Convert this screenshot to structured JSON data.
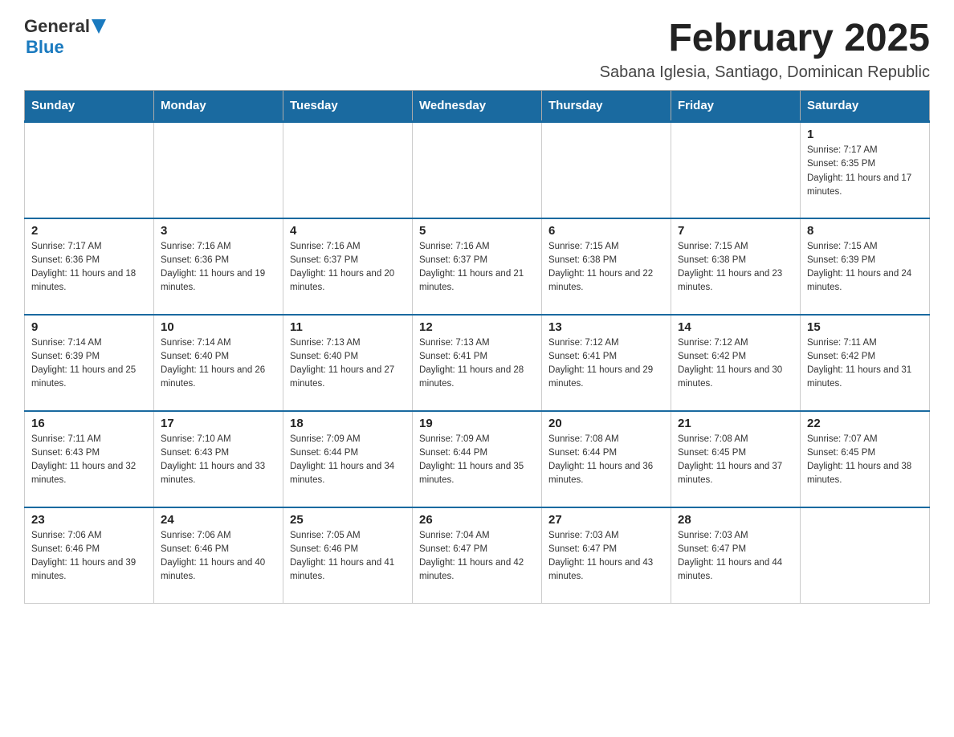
{
  "header": {
    "logo_general": "General",
    "logo_blue": "Blue",
    "title": "February 2025",
    "subtitle": "Sabana Iglesia, Santiago, Dominican Republic"
  },
  "weekdays": [
    "Sunday",
    "Monday",
    "Tuesday",
    "Wednesday",
    "Thursday",
    "Friday",
    "Saturday"
  ],
  "weeks": [
    [
      {
        "day": "",
        "sunrise": "",
        "sunset": "",
        "daylight": ""
      },
      {
        "day": "",
        "sunrise": "",
        "sunset": "",
        "daylight": ""
      },
      {
        "day": "",
        "sunrise": "",
        "sunset": "",
        "daylight": ""
      },
      {
        "day": "",
        "sunrise": "",
        "sunset": "",
        "daylight": ""
      },
      {
        "day": "",
        "sunrise": "",
        "sunset": "",
        "daylight": ""
      },
      {
        "day": "",
        "sunrise": "",
        "sunset": "",
        "daylight": ""
      },
      {
        "day": "1",
        "sunrise": "Sunrise: 7:17 AM",
        "sunset": "Sunset: 6:35 PM",
        "daylight": "Daylight: 11 hours and 17 minutes."
      }
    ],
    [
      {
        "day": "2",
        "sunrise": "Sunrise: 7:17 AM",
        "sunset": "Sunset: 6:36 PM",
        "daylight": "Daylight: 11 hours and 18 minutes."
      },
      {
        "day": "3",
        "sunrise": "Sunrise: 7:16 AM",
        "sunset": "Sunset: 6:36 PM",
        "daylight": "Daylight: 11 hours and 19 minutes."
      },
      {
        "day": "4",
        "sunrise": "Sunrise: 7:16 AM",
        "sunset": "Sunset: 6:37 PM",
        "daylight": "Daylight: 11 hours and 20 minutes."
      },
      {
        "day": "5",
        "sunrise": "Sunrise: 7:16 AM",
        "sunset": "Sunset: 6:37 PM",
        "daylight": "Daylight: 11 hours and 21 minutes."
      },
      {
        "day": "6",
        "sunrise": "Sunrise: 7:15 AM",
        "sunset": "Sunset: 6:38 PM",
        "daylight": "Daylight: 11 hours and 22 minutes."
      },
      {
        "day": "7",
        "sunrise": "Sunrise: 7:15 AM",
        "sunset": "Sunset: 6:38 PM",
        "daylight": "Daylight: 11 hours and 23 minutes."
      },
      {
        "day": "8",
        "sunrise": "Sunrise: 7:15 AM",
        "sunset": "Sunset: 6:39 PM",
        "daylight": "Daylight: 11 hours and 24 minutes."
      }
    ],
    [
      {
        "day": "9",
        "sunrise": "Sunrise: 7:14 AM",
        "sunset": "Sunset: 6:39 PM",
        "daylight": "Daylight: 11 hours and 25 minutes."
      },
      {
        "day": "10",
        "sunrise": "Sunrise: 7:14 AM",
        "sunset": "Sunset: 6:40 PM",
        "daylight": "Daylight: 11 hours and 26 minutes."
      },
      {
        "day": "11",
        "sunrise": "Sunrise: 7:13 AM",
        "sunset": "Sunset: 6:40 PM",
        "daylight": "Daylight: 11 hours and 27 minutes."
      },
      {
        "day": "12",
        "sunrise": "Sunrise: 7:13 AM",
        "sunset": "Sunset: 6:41 PM",
        "daylight": "Daylight: 11 hours and 28 minutes."
      },
      {
        "day": "13",
        "sunrise": "Sunrise: 7:12 AM",
        "sunset": "Sunset: 6:41 PM",
        "daylight": "Daylight: 11 hours and 29 minutes."
      },
      {
        "day": "14",
        "sunrise": "Sunrise: 7:12 AM",
        "sunset": "Sunset: 6:42 PM",
        "daylight": "Daylight: 11 hours and 30 minutes."
      },
      {
        "day": "15",
        "sunrise": "Sunrise: 7:11 AM",
        "sunset": "Sunset: 6:42 PM",
        "daylight": "Daylight: 11 hours and 31 minutes."
      }
    ],
    [
      {
        "day": "16",
        "sunrise": "Sunrise: 7:11 AM",
        "sunset": "Sunset: 6:43 PM",
        "daylight": "Daylight: 11 hours and 32 minutes."
      },
      {
        "day": "17",
        "sunrise": "Sunrise: 7:10 AM",
        "sunset": "Sunset: 6:43 PM",
        "daylight": "Daylight: 11 hours and 33 minutes."
      },
      {
        "day": "18",
        "sunrise": "Sunrise: 7:09 AM",
        "sunset": "Sunset: 6:44 PM",
        "daylight": "Daylight: 11 hours and 34 minutes."
      },
      {
        "day": "19",
        "sunrise": "Sunrise: 7:09 AM",
        "sunset": "Sunset: 6:44 PM",
        "daylight": "Daylight: 11 hours and 35 minutes."
      },
      {
        "day": "20",
        "sunrise": "Sunrise: 7:08 AM",
        "sunset": "Sunset: 6:44 PM",
        "daylight": "Daylight: 11 hours and 36 minutes."
      },
      {
        "day": "21",
        "sunrise": "Sunrise: 7:08 AM",
        "sunset": "Sunset: 6:45 PM",
        "daylight": "Daylight: 11 hours and 37 minutes."
      },
      {
        "day": "22",
        "sunrise": "Sunrise: 7:07 AM",
        "sunset": "Sunset: 6:45 PM",
        "daylight": "Daylight: 11 hours and 38 minutes."
      }
    ],
    [
      {
        "day": "23",
        "sunrise": "Sunrise: 7:06 AM",
        "sunset": "Sunset: 6:46 PM",
        "daylight": "Daylight: 11 hours and 39 minutes."
      },
      {
        "day": "24",
        "sunrise": "Sunrise: 7:06 AM",
        "sunset": "Sunset: 6:46 PM",
        "daylight": "Daylight: 11 hours and 40 minutes."
      },
      {
        "day": "25",
        "sunrise": "Sunrise: 7:05 AM",
        "sunset": "Sunset: 6:46 PM",
        "daylight": "Daylight: 11 hours and 41 minutes."
      },
      {
        "day": "26",
        "sunrise": "Sunrise: 7:04 AM",
        "sunset": "Sunset: 6:47 PM",
        "daylight": "Daylight: 11 hours and 42 minutes."
      },
      {
        "day": "27",
        "sunrise": "Sunrise: 7:03 AM",
        "sunset": "Sunset: 6:47 PM",
        "daylight": "Daylight: 11 hours and 43 minutes."
      },
      {
        "day": "28",
        "sunrise": "Sunrise: 7:03 AM",
        "sunset": "Sunset: 6:47 PM",
        "daylight": "Daylight: 11 hours and 44 minutes."
      },
      {
        "day": "",
        "sunrise": "",
        "sunset": "",
        "daylight": ""
      }
    ]
  ]
}
